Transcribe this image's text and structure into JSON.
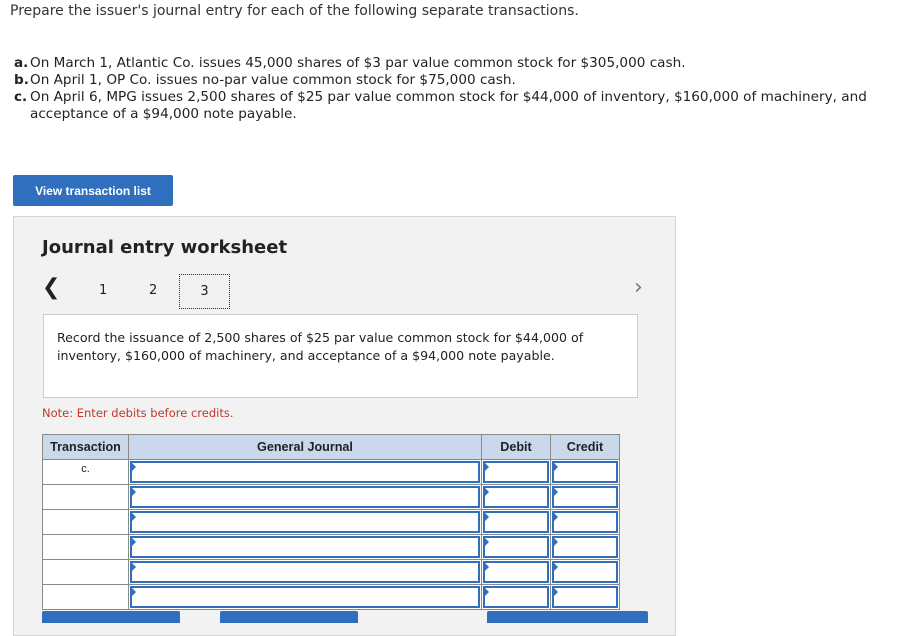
{
  "prompt": "Prepare the issuer's journal entry for each of the following separate transactions.",
  "transactions": [
    {
      "letter": "a.",
      "text": "On March 1, Atlantic Co. issues 45,000 shares of $3 par value common stock for $305,000 cash."
    },
    {
      "letter": "b.",
      "text": "On April 1, OP Co. issues no-par value common stock for $75,000 cash."
    },
    {
      "letter": "c.",
      "text": "On April 6, MPG issues 2,500 shares of $25 par value common stock for $44,000 of inventory, $160,000 of machinery, and acceptance of a $94,000 note payable."
    }
  ],
  "view_button": "View transaction list",
  "worksheet": {
    "title": "Journal entry worksheet",
    "pages": [
      "1",
      "2",
      "3"
    ],
    "active_page": "3",
    "description": "Record the issuance of 2,500 shares of $25 par value common stock for $44,000 of inventory, $160,000 of machinery, and acceptance of a $94,000 note payable.",
    "note": "Note: Enter debits before credits.",
    "table": {
      "headers": {
        "transaction": "Transaction",
        "journal": "General Journal",
        "debit": "Debit",
        "credit": "Credit"
      },
      "rows": [
        {
          "transaction": "c.",
          "journal": "",
          "debit": "",
          "credit": ""
        },
        {
          "transaction": "",
          "journal": "",
          "debit": "",
          "credit": ""
        },
        {
          "transaction": "",
          "journal": "",
          "debit": "",
          "credit": ""
        },
        {
          "transaction": "",
          "journal": "",
          "debit": "",
          "credit": ""
        },
        {
          "transaction": "",
          "journal": "",
          "debit": "",
          "credit": ""
        },
        {
          "transaction": "",
          "journal": "",
          "debit": "",
          "credit": ""
        }
      ]
    }
  },
  "icons": {
    "prev": "chevron-left-icon",
    "next": "chevron-right-icon"
  },
  "colors": {
    "accent": "#2f6fbe",
    "table_header": "#c9d8ea",
    "note": "#c0392b"
  }
}
